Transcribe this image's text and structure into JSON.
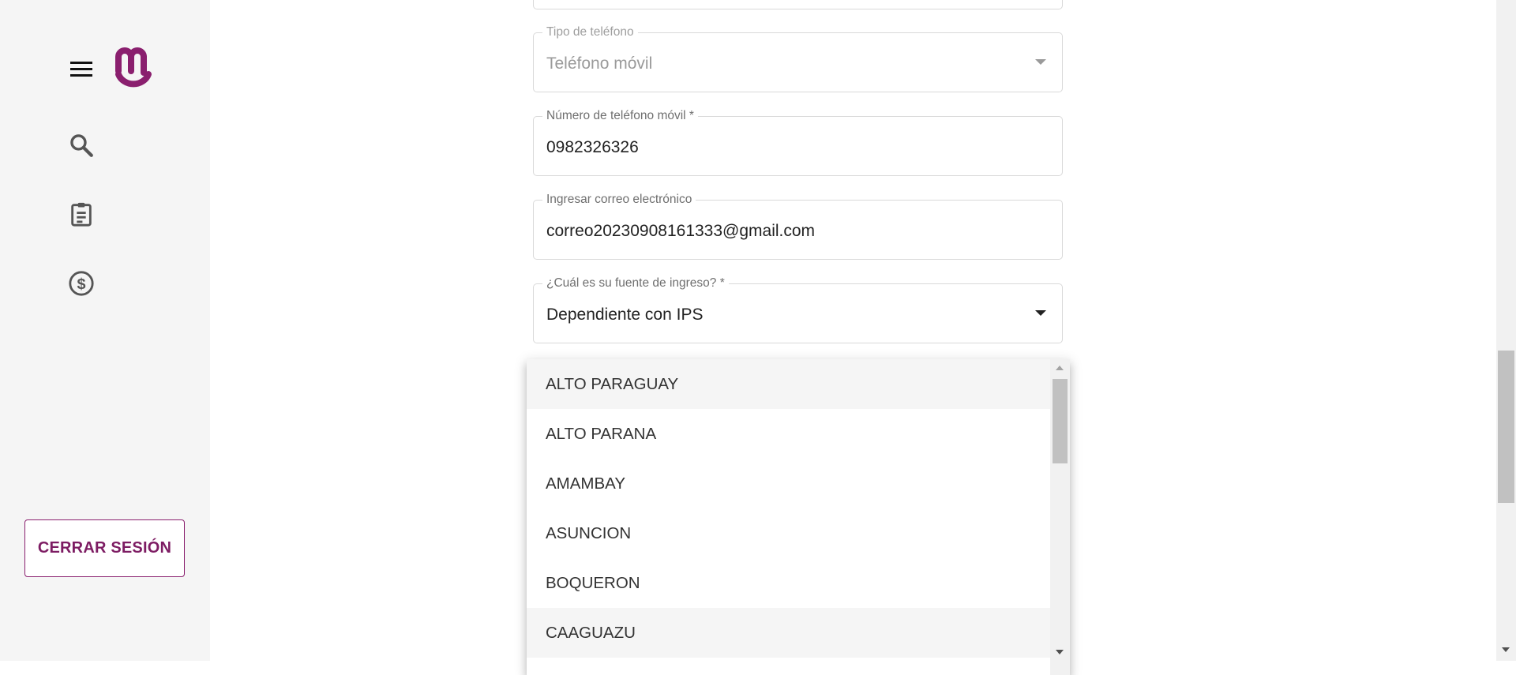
{
  "sidebar": {
    "menu_icon": "menu-icon",
    "logo": "brand-logo",
    "nav_icons": [
      "search-icon",
      "clipboard-icon",
      "dollar-circle-icon"
    ],
    "logout_label": "CERRAR SESIÓN"
  },
  "form": {
    "phone_type": {
      "label": "Tipo de teléfono",
      "value": "Teléfono móvil"
    },
    "mobile_number": {
      "label": "Número de teléfono móvil *",
      "value": "0982326326"
    },
    "email": {
      "label": "Ingresar correo electrónico",
      "value": "correo20230908161333@gmail.com"
    },
    "income_source": {
      "label": "¿Cuál es su fuente de ingreso? *",
      "value": "Dependiente con IPS"
    }
  },
  "dropdown": {
    "options": [
      "ALTO PARAGUAY",
      "ALTO PARANA",
      "AMAMBAY",
      "ASUNCION",
      "BOQUERON",
      "CAAGUAZU"
    ]
  },
  "colors": {
    "brand": "#8a1f6e",
    "sidebar_bg": "#f5f5f5"
  }
}
